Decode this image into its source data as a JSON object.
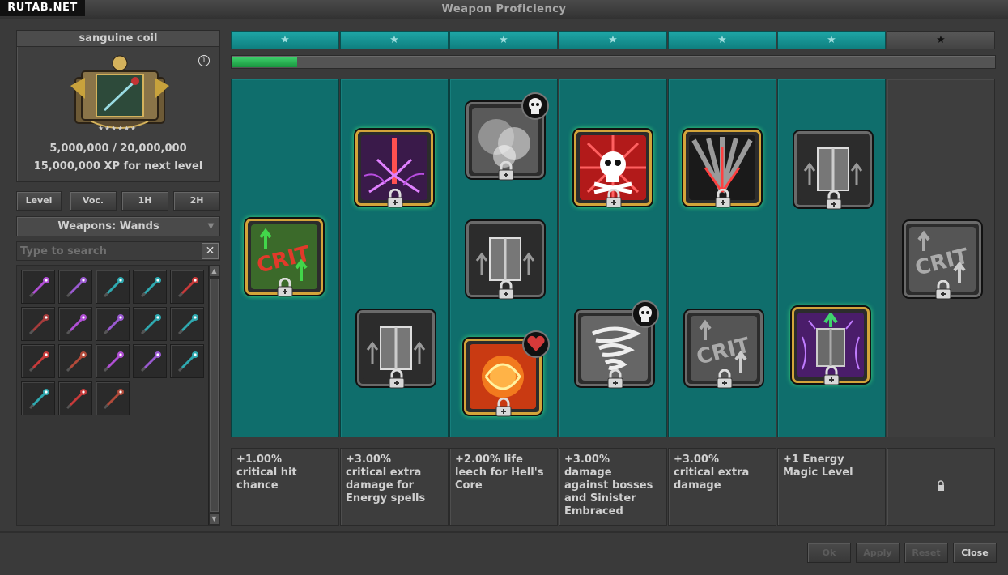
{
  "window": {
    "title": "Weapon Proficiency",
    "watermark": "RUTAB.NET"
  },
  "weapon": {
    "name": "sanguine coil",
    "info_icon": "info-icon",
    "stars": 6,
    "xp_progress": "5,000,000 / 20,000,000",
    "xp_next": "15,000,000 XP for next level"
  },
  "filters": {
    "level": "Level",
    "voc": "Voc.",
    "one_hand": "1H",
    "two_hand": "2H"
  },
  "weapon_select": {
    "selected": "Weapons: Wands",
    "arrow_icon": "dropdown-arrow-icon"
  },
  "search": {
    "placeholder": "Type to search",
    "clear_label": "✕"
  },
  "wands": [
    {
      "color": "#b04fd4"
    },
    {
      "color": "#9a5ad0"
    },
    {
      "color": "#2fa9b0"
    },
    {
      "color": "#2fa9b0"
    },
    {
      "color": "#c83a3a"
    },
    {
      "color": "#a63c3c"
    },
    {
      "color": "#b04fd4"
    },
    {
      "color": "#9a5ad0"
    },
    {
      "color": "#2fa9b0"
    },
    {
      "color": "#2fa9b0"
    },
    {
      "color": "#c83a3a"
    },
    {
      "color": "#b24a3a"
    },
    {
      "color": "#b04fd4"
    },
    {
      "color": "#9a5ad0"
    },
    {
      "color": "#2fa9b0"
    },
    {
      "color": "#2fa9b0"
    },
    {
      "color": "#c83a3a"
    },
    {
      "color": "#b24a3a"
    }
  ],
  "star_bar": {
    "star_glyph": "★",
    "levels_unlocked": 6,
    "levels_total": 7
  },
  "progress": {
    "fraction": 0.085
  },
  "perk_columns": [
    {
      "perks": [
        {
          "name": "crit-chance",
          "icon": "crit-icon",
          "active": true
        }
      ],
      "description": "+1.00%\ncritical hit\nchance"
    },
    {
      "perks": [
        {
          "name": "energy-crit-damage",
          "icon": "energy-strike-icon",
          "active": true
        },
        {
          "name": "spellbook-hp",
          "icon": "spellbook-icon",
          "active": false
        }
      ],
      "description": "+3.00%\ncritical extra\ndamage for\nEnergy spells"
    },
    {
      "perks": [
        {
          "name": "smoke-perk",
          "icon": "smoke-icon",
          "active": false,
          "badge": "skull-badge"
        },
        {
          "name": "spellbook-mana",
          "icon": "spellbook-icon",
          "active": false
        },
        {
          "name": "hells-core",
          "icon": "fire-swirl-icon",
          "active": true,
          "badge": "heart-badge"
        }
      ],
      "description": "+2.00% life\nleech for Hell's\nCore"
    },
    {
      "perks": [
        {
          "name": "boss-damage",
          "icon": "skull-crossbones-icon",
          "active": true
        },
        {
          "name": "wind-perk",
          "icon": "whirlwind-icon",
          "active": false,
          "badge": "skull-badge"
        }
      ],
      "description": "+3.00%\ndamage\nagainst bosses\nand Sinister\nEmbraced"
    },
    {
      "perks": [
        {
          "name": "crit-extra-damage",
          "icon": "light-rays-icon",
          "active": true
        },
        {
          "name": "crit-perk-grey",
          "icon": "crit-icon",
          "active": false
        }
      ],
      "description": "+3.00%\ncritical extra\ndamage"
    },
    {
      "perks": [
        {
          "name": "spellbook-grey",
          "icon": "spellbook-icon",
          "active": false
        },
        {
          "name": "energy-magic-level",
          "icon": "energy-book-icon",
          "active": true
        }
      ],
      "description": "+1 Energy\nMagic Level"
    },
    {
      "perks": [
        {
          "name": "crit-locked",
          "icon": "crit-icon",
          "active": false
        }
      ],
      "description": ""
    }
  ],
  "buttons": {
    "ok": "Ok",
    "apply": "Apply",
    "reset": "Reset",
    "close": "Close"
  },
  "colors": {
    "teal": "#0f6e6c",
    "gold_frame": "#d3a43a",
    "progress_green": "#2ab553"
  }
}
